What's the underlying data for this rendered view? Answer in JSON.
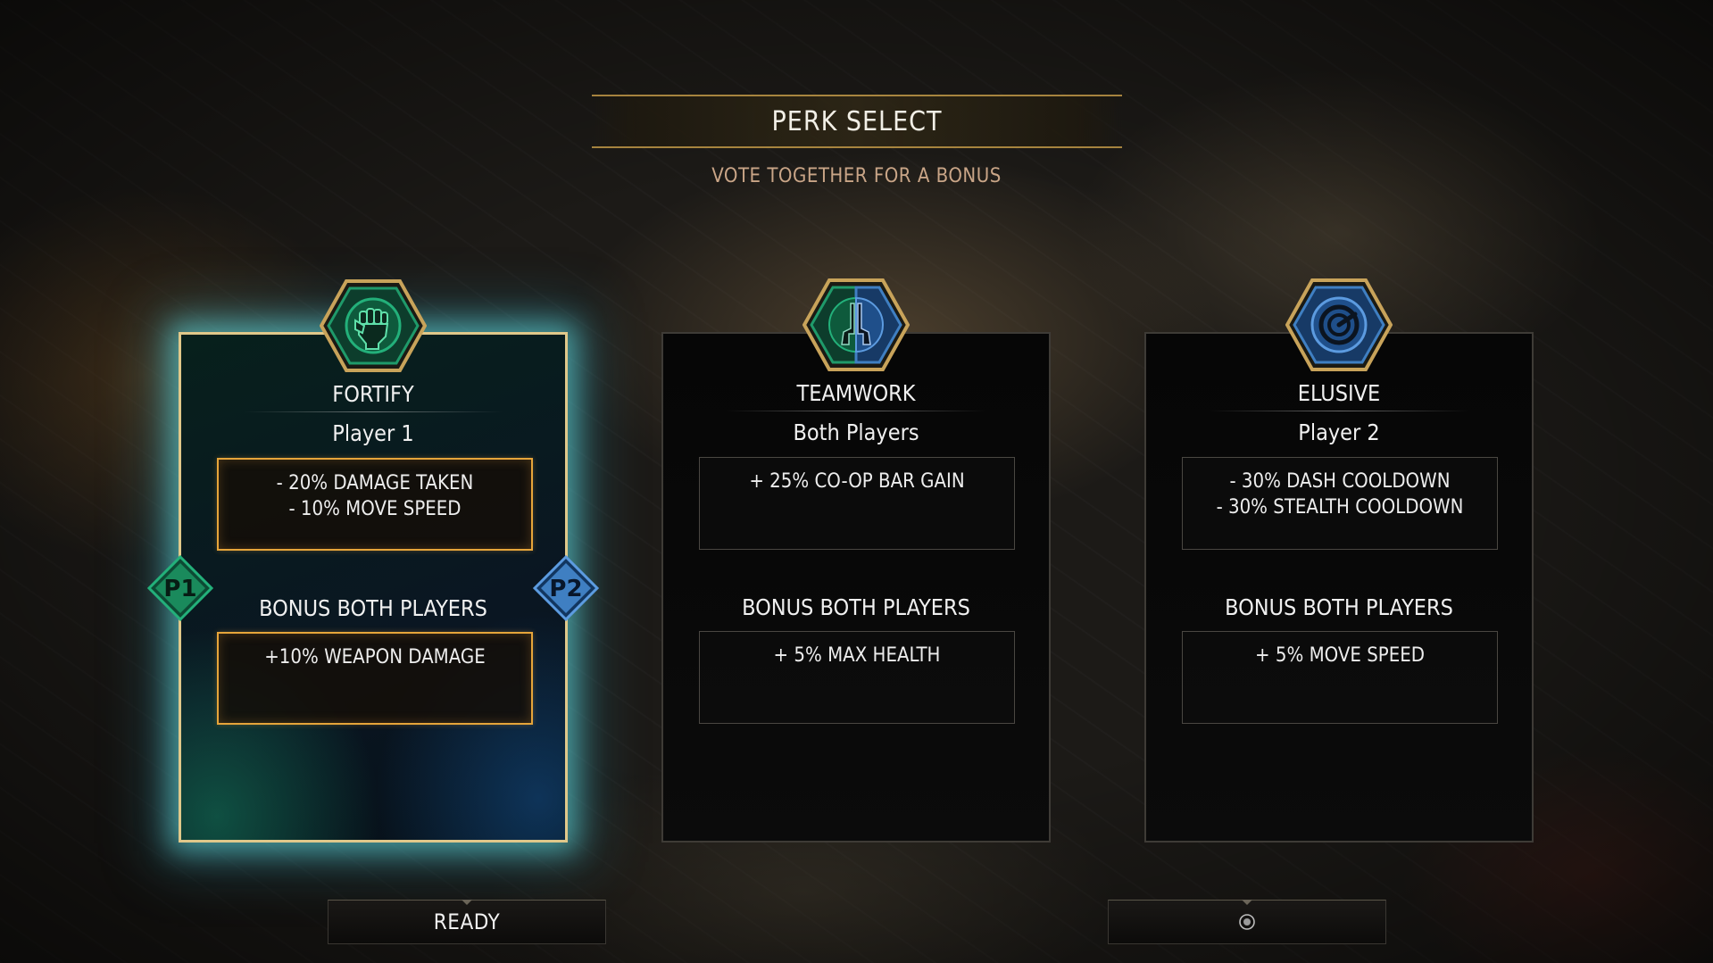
{
  "screen": {
    "title": "PERK SELECT",
    "subtitle": "VOTE TOGETHER FOR A BONUS"
  },
  "cards": [
    {
      "name": "FORTIFY",
      "target": "Player 1",
      "icon": "fist-icon",
      "selected": true,
      "primary": [
        "- 20% DAMAGE TAKEN",
        "- 10% MOVE SPEED"
      ],
      "bonus_heading": "BONUS BOTH PLAYERS",
      "bonus": [
        "+10% WEAPON DAMAGE"
      ]
    },
    {
      "name": "TEAMWORK",
      "target": "Both Players",
      "icon": "dual-pistols-icon",
      "selected": false,
      "primary": [
        "+ 25% CO-OP BAR GAIN"
      ],
      "bonus_heading": "BONUS BOTH PLAYERS",
      "bonus": [
        "+ 5% MAX HEALTH"
      ]
    },
    {
      "name": "ELUSIVE",
      "target": "Player 2",
      "icon": "speed-gauge-icon",
      "selected": false,
      "primary": [
        "- 30% DASH COOLDOWN",
        "- 30% STEALTH COOLDOWN"
      ],
      "bonus_heading": "BONUS BOTH PLAYERS",
      "bonus": [
        "+ 5% MOVE SPEED"
      ]
    }
  ],
  "player_tags": {
    "p1": "P1",
    "p2": "P2"
  },
  "buttons": {
    "ready_label": "READY",
    "p2_icon": "controller-button-icon"
  },
  "colors": {
    "player1": "#1f9a6a",
    "player2": "#3f7fc2",
    "highlight": "#e6a53a",
    "gold": "#c8a35a"
  }
}
